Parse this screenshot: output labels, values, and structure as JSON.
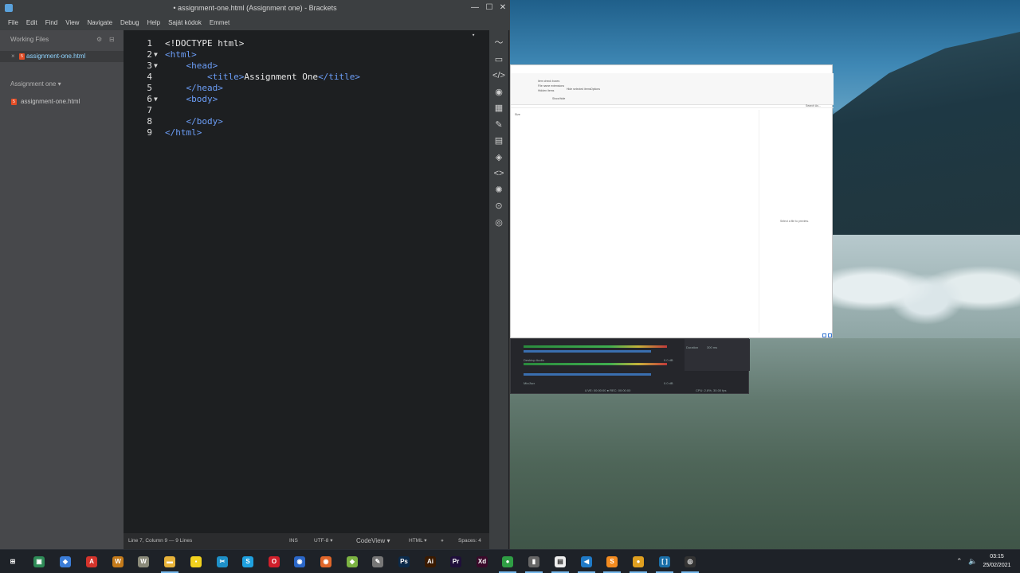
{
  "window": {
    "title": "• assignment-one.html (Assignment one) - Brackets",
    "min": "—",
    "max": "☐",
    "close": "✕"
  },
  "menu": [
    "File",
    "Edit",
    "Find",
    "View",
    "Navigate",
    "Debug",
    "Help",
    "Saját kódok",
    "Emmet"
  ],
  "sidebar": {
    "working_files_label": "Working Files",
    "working_file": "assignment-one.html",
    "project_label": "Assignment one",
    "project_arrow": "▾",
    "project_file": "assignment-one.html",
    "close_glyph": "×",
    "gear_glyph": "⚙",
    "split_glyph": "⊟"
  },
  "editor": {
    "lines": [
      {
        "num": "1",
        "fold": "",
        "indent": "",
        "parts": [
          {
            "t": "<!DOCTYPE html>",
            "c": "text"
          }
        ]
      },
      {
        "num": "2",
        "fold": "▼",
        "indent": "",
        "parts": [
          {
            "t": "<html>",
            "c": "tag"
          }
        ]
      },
      {
        "num": "3",
        "fold": "▼",
        "indent": "    ",
        "parts": [
          {
            "t": "<head>",
            "c": "tag"
          }
        ]
      },
      {
        "num": "4",
        "fold": "",
        "indent": "        ",
        "parts": [
          {
            "t": "<title>",
            "c": "tag"
          },
          {
            "t": "Assignment One",
            "c": "text"
          },
          {
            "t": "</title>",
            "c": "tag"
          }
        ]
      },
      {
        "num": "5",
        "fold": "",
        "indent": "    ",
        "parts": [
          {
            "t": "</head>",
            "c": "tag"
          }
        ]
      },
      {
        "num": "6",
        "fold": "▼",
        "indent": "    ",
        "parts": [
          {
            "t": "<body>",
            "c": "tag"
          }
        ]
      },
      {
        "num": "7",
        "fold": "",
        "indent": "",
        "parts": []
      },
      {
        "num": "8",
        "fold": "",
        "indent": "    ",
        "parts": [
          {
            "t": "</body>",
            "c": "tag"
          }
        ]
      },
      {
        "num": "9",
        "fold": "",
        "indent": "",
        "parts": [
          {
            "t": "</html>",
            "c": "tag"
          }
        ]
      }
    ],
    "scroll_marker": "▾"
  },
  "statusbar": {
    "position": "Line 7, Column 9 — 9 Lines",
    "mode": "INS",
    "encoding": "UTF-8 ▾",
    "view": "CodeView ▾",
    "language": "HTML ▾",
    "lint": "●",
    "spaces": "Spaces: 4"
  },
  "toolbar_icons": [
    "live-preview-icon",
    "extension-icon",
    "code-icon",
    "eye-icon",
    "checker-icon",
    "tools-icon",
    "notes-icon",
    "git-icon",
    "brackets-icon",
    "lightbulb-icon",
    "lamp-icon",
    "preview-eye-icon"
  ],
  "explorer": {
    "options_a": "Item check boxes",
    "options_b": "File name extensions",
    "options_c": "Hidden items",
    "hide_selected": "Hide selected items",
    "options_btn": "Options",
    "show_hide": "Show/hide",
    "search": "Search As...",
    "pane_label": "Size",
    "preview_text": "Select a file to preview."
  },
  "obs": {
    "desktop_audio": "Desktop Audio",
    "mic": "Mic/Aux",
    "duration_label": "Duration",
    "duration_value": "300 ms",
    "status": "LIVE: 00:00:00   ● REC: 00:00:00",
    "cpu": "CPU: 2.8%, 30.00 fps",
    "db1": "0.0 dB",
    "db2": "0.0 dB"
  },
  "taskbar": {
    "time": "03:15",
    "date": "25/02/2021",
    "icons": [
      {
        "name": "windows-start-icon",
        "label": "⊞",
        "bg": "transparent"
      },
      {
        "name": "app-green-icon",
        "label": "▣",
        "bg": "#2e8b57"
      },
      {
        "name": "app-3d-icon",
        "label": "◆",
        "bg": "#3b7dd8"
      },
      {
        "name": "acrobat-icon",
        "label": "A",
        "bg": "#d4342c"
      },
      {
        "name": "game-icon",
        "label": "W",
        "bg": "#c47a1a"
      },
      {
        "name": "word-icon",
        "label": "W",
        "bg": "#8a8a7a"
      },
      {
        "name": "file-explorer-icon",
        "label": "▬",
        "bg": "#e8b33a"
      },
      {
        "name": "sticky-notes-icon",
        "label": "▪",
        "bg": "#f2d21e"
      },
      {
        "name": "snip-icon",
        "label": "✂",
        "bg": "#1e90c8"
      },
      {
        "name": "skype-icon",
        "label": "S",
        "bg": "#1fa1e0"
      },
      {
        "name": "opera-icon",
        "label": "O",
        "bg": "#d01f2b"
      },
      {
        "name": "firefox-dev-icon",
        "label": "◉",
        "bg": "#2b67c8"
      },
      {
        "name": "firefox-icon",
        "label": "◉",
        "bg": "#e0662a"
      },
      {
        "name": "sketchup-icon",
        "label": "◆",
        "bg": "#7cb342"
      },
      {
        "name": "inkscape-icon",
        "label": "✎",
        "bg": "#777"
      },
      {
        "name": "photoshop-icon",
        "label": "Ps",
        "bg": "#0b2a4a"
      },
      {
        "name": "illustrator-icon",
        "label": "Ai",
        "bg": "#3a1a00"
      },
      {
        "name": "premiere-icon",
        "label": "Pr",
        "bg": "#1f0f3a"
      },
      {
        "name": "xd-icon",
        "label": "Xd",
        "bg": "#3a0a2a"
      },
      {
        "name": "chrome-icon",
        "label": "●",
        "bg": "#2f9e44"
      },
      {
        "name": "usb-icon",
        "label": "▮",
        "bg": "#666"
      },
      {
        "name": "notepad-icon",
        "label": "▤",
        "bg": "#eeeeee"
      },
      {
        "name": "vscode-icon",
        "label": "◀",
        "bg": "#1f7ac7"
      },
      {
        "name": "sublime-icon",
        "label": "S",
        "bg": "#f38b20"
      },
      {
        "name": "chrome-canary-icon",
        "label": "●",
        "bg": "#e0a020"
      },
      {
        "name": "brackets-taskbar-icon",
        "label": "[ ]",
        "bg": "#1a6fa8"
      },
      {
        "name": "obs-icon",
        "label": "◎",
        "bg": "#333"
      }
    ]
  }
}
